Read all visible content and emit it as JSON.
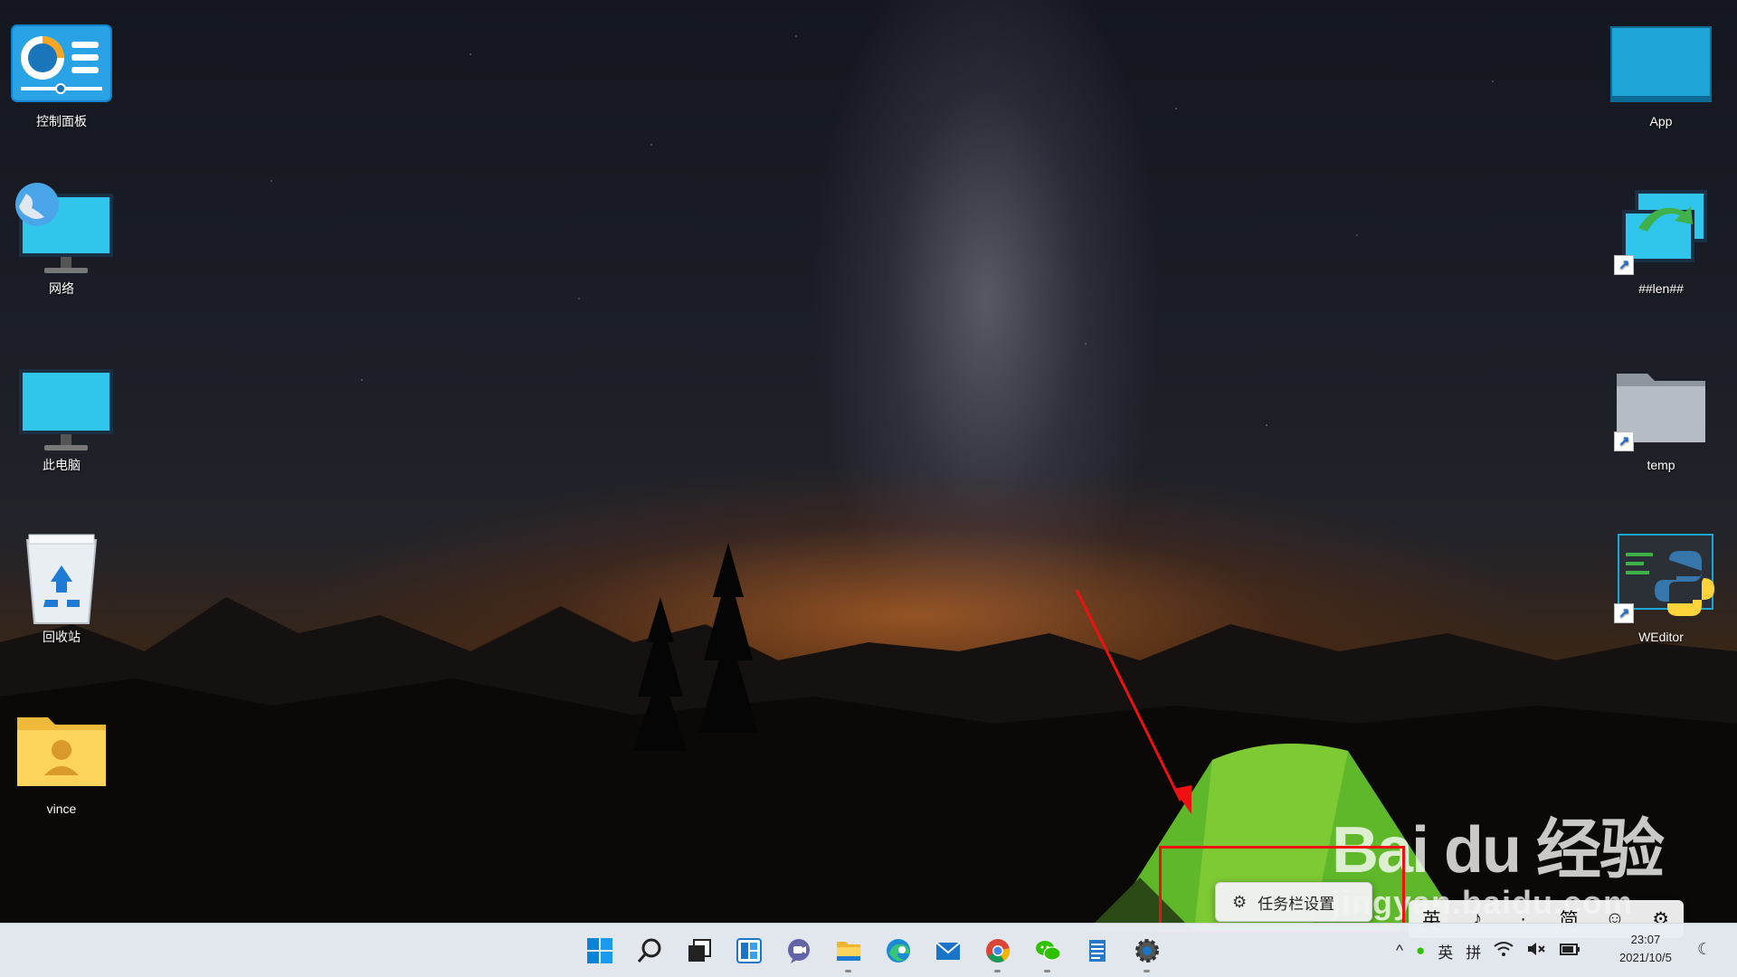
{
  "desktop": {
    "left_icons": [
      {
        "label": "控制面板",
        "icon": "control-panel-icon"
      },
      {
        "label": "网络",
        "icon": "network-icon"
      },
      {
        "label": "此电脑",
        "icon": "this-pc-icon"
      },
      {
        "label": "回收站",
        "icon": "recycle-bin-icon"
      },
      {
        "label": "vince",
        "icon": "user-folder-icon"
      }
    ],
    "right_icons": [
      {
        "label": "App",
        "icon": "app-icon"
      },
      {
        "label": "##len##",
        "icon": "remote-desktop-icon"
      },
      {
        "label": "temp",
        "icon": "folder-icon"
      },
      {
        "label": "WEditor",
        "icon": "python-icon"
      }
    ]
  },
  "context_menu": {
    "item_label": "任务栏设置",
    "icon": "gear-icon"
  },
  "ime_toolbar": {
    "items": [
      "英",
      "♪",
      "·",
      "简",
      "☺",
      "⚙"
    ]
  },
  "watermark": {
    "logo": "Bai du 经验",
    "url": "jingyan.baidu.com"
  },
  "taskbar": {
    "apps": [
      "start",
      "search",
      "task-view",
      "widgets",
      "teams-chat",
      "file-explorer",
      "edge",
      "mail",
      "chrome",
      "wechat",
      "notepad",
      "settings"
    ],
    "tray": {
      "chevron": "^",
      "lang": "英",
      "input": "拼",
      "time": "23:07",
      "date": "2021/10/5"
    }
  },
  "colors": {
    "annotation_red": "#e11111",
    "accent_blue": "#0078d4"
  }
}
